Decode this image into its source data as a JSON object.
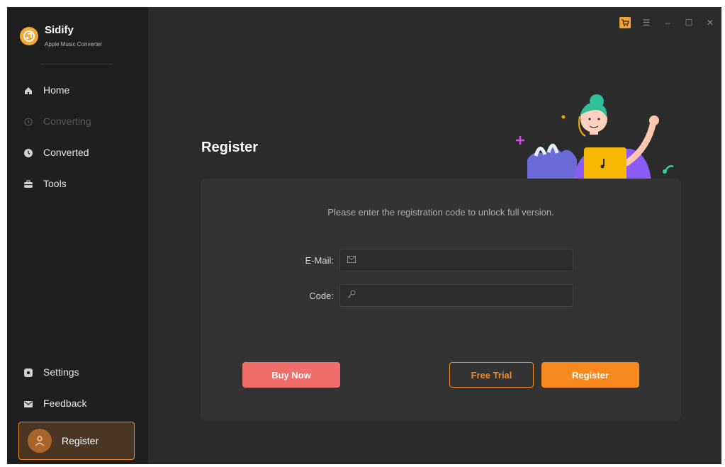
{
  "app": {
    "name": "Sidify",
    "subtitle": "Apple Music Converter"
  },
  "sidebar": {
    "items": [
      {
        "label": "Home",
        "icon": "home-icon",
        "enabled": true
      },
      {
        "label": "Converting",
        "icon": "converting-icon",
        "enabled": false
      },
      {
        "label": "Converted",
        "icon": "clock-icon",
        "enabled": true
      },
      {
        "label": "Tools",
        "icon": "toolbox-icon",
        "enabled": true
      }
    ],
    "bottom_items": [
      {
        "label": "Settings",
        "icon": "gear-icon"
      },
      {
        "label": "Feedback",
        "icon": "mail-icon"
      }
    ],
    "register_label": "Register"
  },
  "main": {
    "title": "Register",
    "instruction": "Please enter the registration code to unlock full version.",
    "email_label": "E-Mail:",
    "email_value": "",
    "code_label": "Code:",
    "code_value": "",
    "buttons": {
      "buy_now": "Buy Now",
      "free_trial": "Free Trial",
      "register": "Register"
    }
  },
  "colors": {
    "accent": "#f6881d",
    "buy_button": "#f06e6a",
    "background": "#2b2b2b",
    "sidebar": "#1f1f1f",
    "panel": "#333333"
  }
}
